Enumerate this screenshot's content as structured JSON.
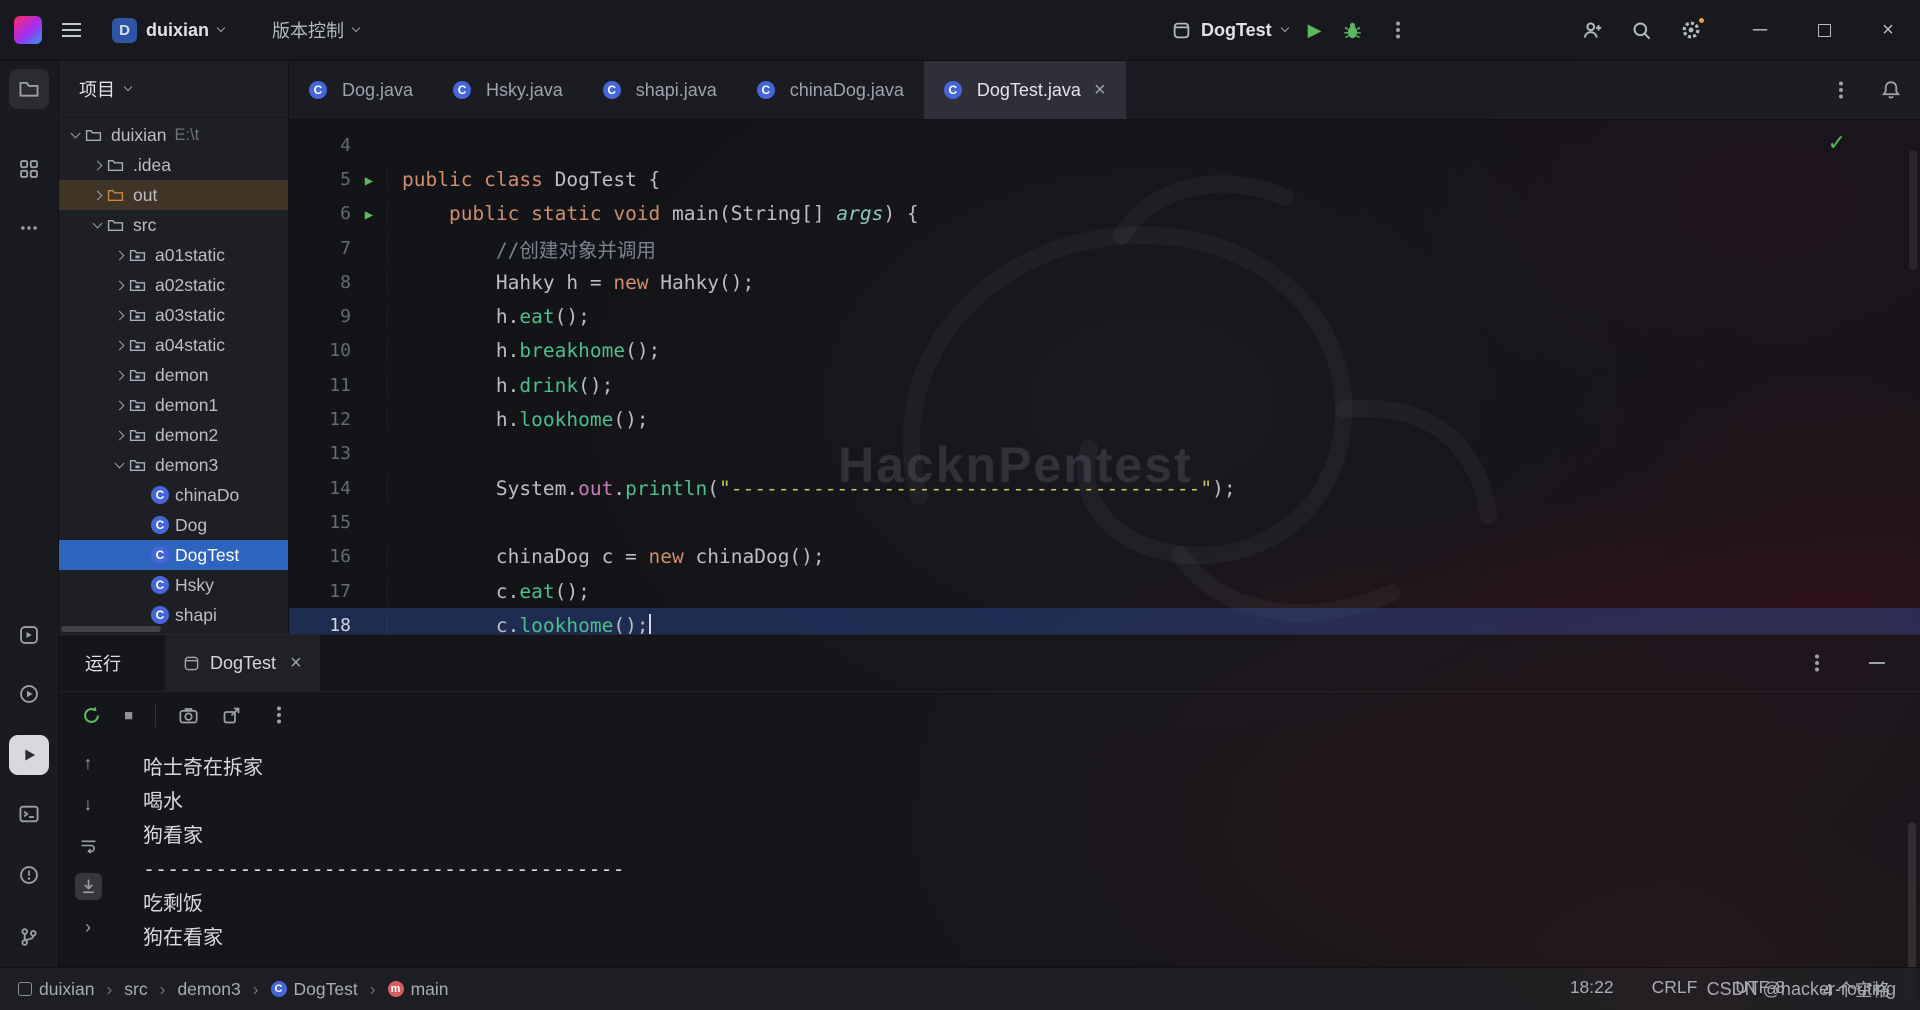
{
  "icons": {
    "play": "▶",
    "run_line": "▶",
    "check": "✓",
    "close": "×",
    "min": "─",
    "stop": "■",
    "up": "↑",
    "down": "↓",
    "chevron_collapsed": "›",
    "breadcrumb_sep": "›",
    "class_letter": "C",
    "method_letter": "m"
  },
  "titlebar": {
    "project_letter": "D",
    "project_name": "duixian",
    "vcs_label": "版本控制",
    "run_config": "DogTest"
  },
  "project_panel": {
    "header": "项目",
    "tree": [
      {
        "label": "duixian",
        "hint": "E:\\t",
        "icon": "project",
        "level": 0,
        "chevron": "down"
      },
      {
        "label": ".idea",
        "icon": "folder",
        "level": 1,
        "chevron": "right"
      },
      {
        "label": "out",
        "icon": "folder",
        "level": 1,
        "chevron": "right",
        "excluded": true
      },
      {
        "label": "src",
        "icon": "folder",
        "level": 1,
        "chevron": "down"
      },
      {
        "label": "a01static",
        "icon": "package",
        "level": 2,
        "chevron": "right"
      },
      {
        "label": "a02static",
        "icon": "package",
        "level": 2,
        "chevron": "right"
      },
      {
        "label": "a03static",
        "icon": "package",
        "level": 2,
        "chevron": "right"
      },
      {
        "label": "a04static",
        "icon": "package",
        "level": 2,
        "chevron": "right"
      },
      {
        "label": "demon",
        "icon": "package",
        "level": 2,
        "chevron": "right"
      },
      {
        "label": "demon1",
        "icon": "package",
        "level": 2,
        "chevron": "right"
      },
      {
        "label": "demon2",
        "icon": "package",
        "level": 2,
        "chevron": "right"
      },
      {
        "label": "demon3",
        "icon": "package",
        "level": 2,
        "chevron": "down"
      },
      {
        "label": "chinaDo",
        "icon": "class",
        "level": 3
      },
      {
        "label": "Dog",
        "icon": "class",
        "level": 3
      },
      {
        "label": "DogTest",
        "icon": "class",
        "level": 3,
        "selected": true
      },
      {
        "label": "Hsky",
        "icon": "class",
        "level": 3
      },
      {
        "label": "shapi",
        "icon": "class",
        "level": 3
      }
    ]
  },
  "editor": {
    "tabs": [
      {
        "label": "Dog.java"
      },
      {
        "label": "Hsky.java"
      },
      {
        "label": "shapi.java"
      },
      {
        "label": "chinaDog.java"
      },
      {
        "label": "DogTest.java",
        "active": true
      }
    ],
    "watermark": "HacknPentest",
    "lines": [
      {
        "num": "4",
        "tokens": []
      },
      {
        "num": "5",
        "run": true,
        "tokens": [
          [
            "public class ",
            "kw"
          ],
          [
            "DogTest {",
            "plain"
          ]
        ]
      },
      {
        "num": "6",
        "run": true,
        "tokens": [
          [
            "    ",
            "plain"
          ],
          [
            "public static void ",
            "kw"
          ],
          [
            "main(String[] ",
            "plain"
          ],
          [
            "args",
            "param"
          ],
          [
            ") {",
            "plain"
          ]
        ]
      },
      {
        "num": "7",
        "tokens": [
          [
            "        ",
            "plain"
          ],
          [
            "//创建对象并调用",
            "cmt"
          ]
        ]
      },
      {
        "num": "8",
        "tokens": [
          [
            "        Hahky h = ",
            "plain"
          ],
          [
            "new ",
            "kw"
          ],
          [
            "Hahky();",
            "plain"
          ]
        ]
      },
      {
        "num": "9",
        "tokens": [
          [
            "        h.",
            "plain"
          ],
          [
            "eat",
            "method"
          ],
          [
            "();",
            "plain"
          ]
        ]
      },
      {
        "num": "10",
        "tokens": [
          [
            "        h.",
            "plain"
          ],
          [
            "breakhome",
            "method"
          ],
          [
            "();",
            "plain"
          ]
        ]
      },
      {
        "num": "11",
        "tokens": [
          [
            "        h.",
            "plain"
          ],
          [
            "drink",
            "method"
          ],
          [
            "();",
            "plain"
          ]
        ]
      },
      {
        "num": "12",
        "tokens": [
          [
            "        h.",
            "plain"
          ],
          [
            "lookhome",
            "method"
          ],
          [
            "();",
            "plain"
          ]
        ]
      },
      {
        "num": "13",
        "tokens": []
      },
      {
        "num": "14",
        "tokens": [
          [
            "        System.",
            "plain"
          ],
          [
            "out",
            "field"
          ],
          [
            ".",
            "plain"
          ],
          [
            "println",
            "method"
          ],
          [
            "(",
            "plain"
          ],
          [
            "\"----------------------------------------\"",
            "str"
          ],
          [
            ");",
            "plain"
          ]
        ]
      },
      {
        "num": "15",
        "tokens": []
      },
      {
        "num": "16",
        "tokens": [
          [
            "        chinaDog c = ",
            "plain"
          ],
          [
            "new ",
            "kw"
          ],
          [
            "chinaDog();",
            "plain"
          ]
        ]
      },
      {
        "num": "17",
        "tokens": [
          [
            "        c.",
            "plain"
          ],
          [
            "eat",
            "method"
          ],
          [
            "();",
            "plain"
          ]
        ]
      },
      {
        "num": "18",
        "caret": true,
        "tokens": [
          [
            "        c.",
            "plain"
          ],
          [
            "lookhome",
            "method"
          ],
          [
            "();",
            "plain"
          ]
        ]
      }
    ]
  },
  "run_panel": {
    "tool_label": "运行",
    "tab_label": "DogTest",
    "output": [
      "哈士奇在拆家",
      "喝水",
      "狗看家",
      "----------------------------------------",
      "吃剩饭",
      "狗在看家"
    ]
  },
  "statusbar": {
    "breadcrumbs": [
      {
        "label": "duixian",
        "icon": "project"
      },
      {
        "label": "src"
      },
      {
        "label": "demon3"
      },
      {
        "label": "DogTest",
        "icon": "class"
      },
      {
        "label": "main",
        "icon": "method"
      }
    ],
    "items": [
      "18:22",
      "CRLF",
      "UTF-8",
      "4 个空格"
    ],
    "overlay_watermark": "CSDN @hacker-routing"
  }
}
